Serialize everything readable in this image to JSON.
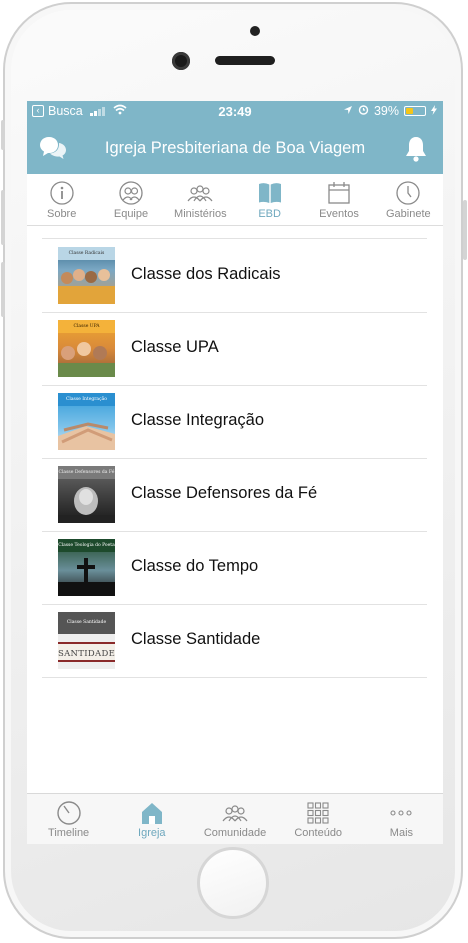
{
  "status_bar": {
    "back_app": "Busca",
    "time": "23:49",
    "battery": "39%",
    "battery_level": 0.39
  },
  "header": {
    "title": "Igreja Presbiteriana de Boa Viagem",
    "accent_color": "#7fb6c8"
  },
  "tabs": [
    {
      "label": "Sobre",
      "icon": "info-icon"
    },
    {
      "label": "Equipe",
      "icon": "team-icon"
    },
    {
      "label": "Ministérios",
      "icon": "ministries-icon"
    },
    {
      "label": "EBD",
      "icon": "book-icon",
      "active": true
    },
    {
      "label": "Eventos",
      "icon": "calendar-icon"
    },
    {
      "label": "Gabinete",
      "icon": "clock-icon"
    }
  ],
  "classes": [
    {
      "name": "Classe dos Radicais",
      "thumb_caption": "Classe Radicais"
    },
    {
      "name": "Classe UPA",
      "thumb_caption": "Classe UPA"
    },
    {
      "name": "Classe Integração",
      "thumb_caption": "Classe Integração"
    },
    {
      "name": "Classe Defensores da Fé",
      "thumb_caption": "Classe Defensores da Fé"
    },
    {
      "name": "Classe do Tempo",
      "thumb_caption": "Classe Teologia do Poeta"
    },
    {
      "name": "Classe Santidade",
      "thumb_caption": "Classe Santidade",
      "thumb_word": "SANTIDADE"
    }
  ],
  "bottom_nav": [
    {
      "label": "Timeline",
      "icon": "timeline-icon"
    },
    {
      "label": "Igreja",
      "icon": "church-icon",
      "active": true
    },
    {
      "label": "Comunidade",
      "icon": "community-icon"
    },
    {
      "label": "Conteúdo",
      "icon": "grid-icon"
    },
    {
      "label": "Mais",
      "icon": "more-icon"
    }
  ]
}
